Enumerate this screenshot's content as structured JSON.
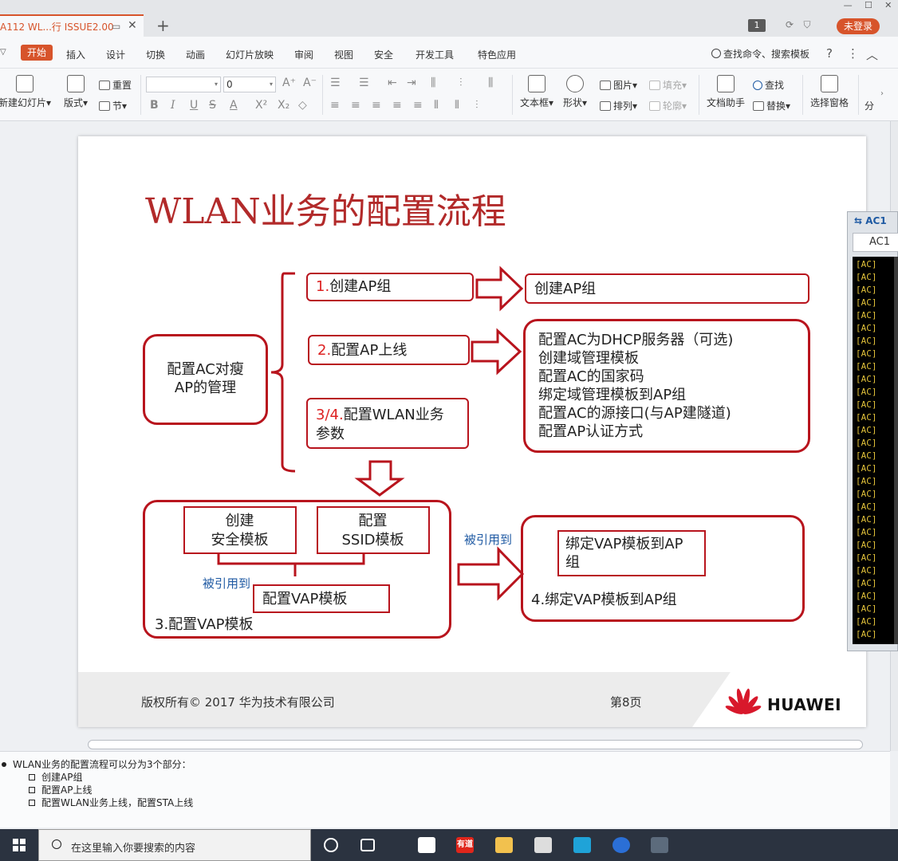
{
  "window": {
    "doc_tab_title": "A112 WL...行 ISSUE2.00",
    "new_tab": "+",
    "page_badge": "1",
    "login": "未登录"
  },
  "menu": {
    "start": "开始",
    "items": [
      "插入",
      "设计",
      "切换",
      "动画",
      "幻灯片放映",
      "审阅",
      "视图",
      "安全",
      "开发工具",
      "特色应用"
    ],
    "search": "查找命令、搜索模板",
    "help": "?"
  },
  "toolbar": {
    "new_slide": "新建幻灯片",
    "layout": "版式",
    "reset": "重置",
    "section": "节",
    "font_size": "0",
    "textbox": "文本框",
    "shape": "形状",
    "picture": "图片",
    "arrange": "排列",
    "fill": "填充",
    "outline": "轮廓",
    "doc_assistant": "文档助手",
    "find": "查找",
    "replace": "替换",
    "select_pane": "选择窗格",
    "more": "分"
  },
  "slide": {
    "title": "WLAN业务的配置流程",
    "main_box": "配置AC对瘦\nAP的管理",
    "step1_num": "1.",
    "step1_text": "创建AP组",
    "step1_result": "创建AP组",
    "step2_num": "2.",
    "step2_text": "配置AP上线",
    "step2_details": [
      "配置AC为DHCP服务器（可选)",
      "创建域管理模板",
      "配置AC的国家码",
      "绑定域管理模板到AP组",
      "配置AC的源接口(与AP建隧道)",
      "配置AP认证方式"
    ],
    "step34_num": "3/4.",
    "step34_line1": "配置WLAN业务",
    "step34_line2": "参数",
    "security_line1": "创建",
    "security_line2": "安全模板",
    "ssid_line1": "配置",
    "ssid_line2": "SSID模板",
    "referenced_left": "被引用到",
    "vap_box": "配置VAP模板",
    "vap_group_label": "3.配置VAP模板",
    "referenced_right": "被引用到",
    "bind_line1": "绑定VAP模板到AP",
    "bind_line2": "组",
    "bind_group_label": "4.绑定VAP模板到AP组",
    "footer_copyright": "版权所有© 2017 华为技术有限公司",
    "footer_page": "第8页",
    "logo_text": "HUAWEI"
  },
  "console": {
    "title": "AC1",
    "tab": "AC1",
    "prompt": "[AC]",
    "line_count": 30
  },
  "notes": {
    "intro": "WLAN业务的配置流程可以分为3个部分：",
    "items": [
      "创建AP组",
      "配置AP上线",
      "配置WLAN业务上线，配置STA上线"
    ]
  },
  "taskbar": {
    "search_placeholder": "在这里输入你要搜索的内容",
    "youdao_label": "有道"
  }
}
